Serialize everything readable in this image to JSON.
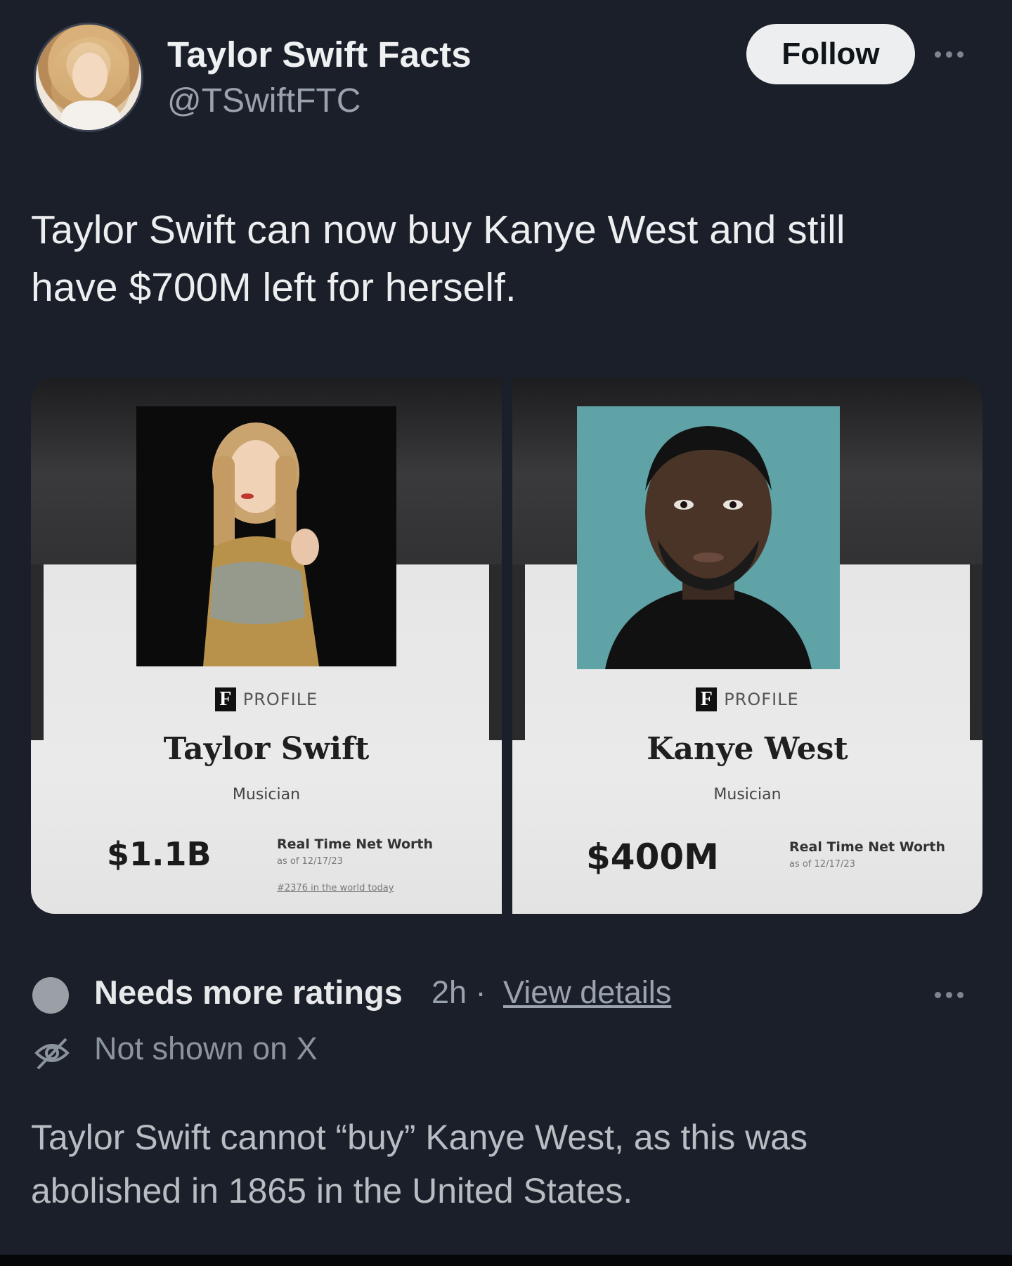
{
  "author": {
    "name": "Taylor Swift Facts",
    "handle": "@TSwiftFTC",
    "follow_label": "Follow"
  },
  "tweet": {
    "text_line1": "Taylor Swift can now buy Kanye West and still",
    "text_line2": "have $700M left for herself."
  },
  "media": {
    "cards": [
      {
        "brand": "F",
        "profile_label": "PROFILE",
        "name": "Taylor Swift",
        "occupation": "Musician",
        "net_worth": "$1.1B",
        "net_worth_label": "Real Time Net Worth",
        "as_of": "as of 12/17/23",
        "rank": "#2376 in the world today"
      },
      {
        "brand": "F",
        "profile_label": "PROFILE",
        "name": "Kanye West",
        "occupation": "Musician",
        "net_worth": "$400M",
        "net_worth_label": "Real Time Net Worth",
        "as_of": "as of 12/17/23"
      }
    ]
  },
  "community_note": {
    "status": "Needs more ratings",
    "time": "2h ·",
    "view_details": "View details",
    "visibility": "Not shown on X",
    "text_line1": "Taylor Swift cannot “buy” Kanye West, as this was",
    "text_line2": "abolished in 1865 in the United States."
  },
  "colors": {
    "background": "#1b1f29",
    "follow_button_bg": "#eceef0",
    "secondary_text": "#9aa3ad"
  },
  "icons": [
    "more-icon",
    "hidden-eye-icon",
    "status-dot-icon",
    "forbes-logo-icon"
  ]
}
